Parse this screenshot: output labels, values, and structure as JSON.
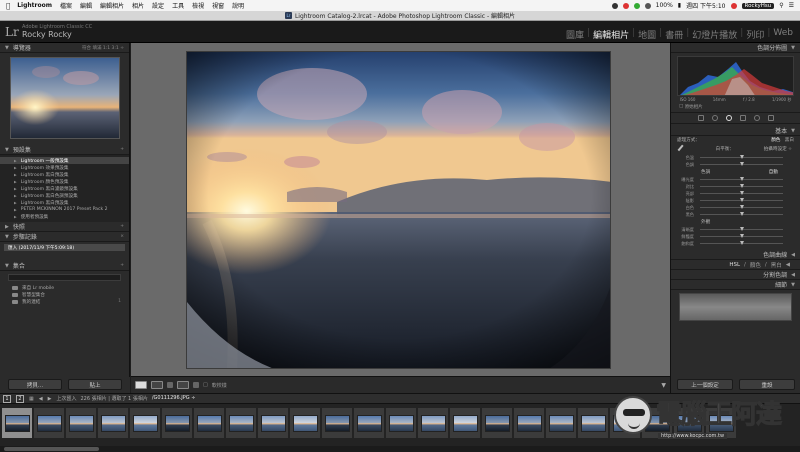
{
  "menubar": {
    "app": "Lightroom",
    "items": [
      "檔案",
      "編輯",
      "編輯相片",
      "相片",
      "設定",
      "工具",
      "檢視",
      "視窗",
      "說明"
    ],
    "battery": "100%",
    "clock": "週四 下午5:10",
    "user": "RockyHsu"
  },
  "window": {
    "title": "Lightroom Catalog-2.lrcat - Adobe Photoshop Lightroom Classic - 編輯相片"
  },
  "identity": {
    "logo": "Lr",
    "subtitle": "Adobe Lightroom Classic CC",
    "name": "Rocky Rocky"
  },
  "modules": {
    "items": [
      "圖庫",
      "編輯相片",
      "地圖",
      "書冊",
      "幻燈片播放",
      "列印",
      "Web"
    ],
    "active_index": 1
  },
  "left": {
    "navigator": {
      "title": "導覽器",
      "options": "符合  填滿  1:1  3:1 ÷"
    },
    "presets": {
      "title": "預設集",
      "items": [
        "Lightroom 一般預設集",
        "Lightroom 效果預設集",
        "Lightroom 黑白預設集",
        "Lightroom 顏色預設集",
        "Lightroom 黑白濾鏡預設集",
        "Lightroom 黑白色調預設集",
        "Lightroom 黑白預設集",
        "PETER MCKINNON 2017 Preset Pack 2",
        "使用者預設集"
      ],
      "selected_index": 0
    },
    "snapshots": {
      "title": "快照"
    },
    "history": {
      "title": "步驟記錄",
      "item": "匯入 (2017/11/9 下午5:09:18)"
    },
    "collections": {
      "title": "集合",
      "search_placeholder": "",
      "items": [
        {
          "name": "來自 Lr mobile",
          "count": ""
        },
        {
          "name": "智慧型集合",
          "count": ""
        },
        {
          "name": "我的連結",
          "count": "1"
        }
      ]
    },
    "buttons": {
      "copy": "拷貝...",
      "paste": "貼上"
    }
  },
  "right": {
    "histogram": {
      "title": "色調分佈圖",
      "info": [
        "ISO 160",
        "14mm",
        "f / 2.8",
        "1/1900 秒"
      ],
      "original": "原始相片"
    },
    "basic": {
      "title": "基本",
      "treatment_label": "處理方式：",
      "color": "顏色",
      "bw": "黑白",
      "wb_label": "白平衡：",
      "wb_value": "拍攝時設定 ÷",
      "sliders_wb": [
        {
          "label": "色溫",
          "pos": 0.5,
          "value": ""
        },
        {
          "label": "色調",
          "pos": 0.5,
          "value": ""
        }
      ],
      "tone_label": "色調",
      "tone_auto": "自動",
      "sliders_tone": [
        {
          "label": "曝光度",
          "pos": 0.5,
          "value": ""
        },
        {
          "label": "對比",
          "pos": 0.5,
          "value": ""
        },
        {
          "label": "亮部",
          "pos": 0.5,
          "value": ""
        },
        {
          "label": "陰影",
          "pos": 0.5,
          "value": ""
        },
        {
          "label": "白色",
          "pos": 0.5,
          "value": ""
        },
        {
          "label": "黑色",
          "pos": 0.5,
          "value": ""
        }
      ],
      "presence_label": "外觀",
      "sliders_presence": [
        {
          "label": "清晰度",
          "pos": 0.5,
          "value": ""
        },
        {
          "label": "鮮豔度",
          "pos": 0.5,
          "value": ""
        },
        {
          "label": "飽和度",
          "pos": 0.5,
          "value": ""
        }
      ]
    },
    "tone_curve": {
      "title": "色調曲線"
    },
    "hsl": {
      "tabs": [
        "HSL",
        "顏色",
        "黑白"
      ],
      "sep": "/"
    },
    "split_toning": {
      "title": "分割色調"
    },
    "calibration": {
      "title": "細節"
    },
    "buttons": {
      "previous": "上一個設定",
      "reset": "重設"
    }
  },
  "toolbar": {
    "label": "軟校樣"
  },
  "filmstrip": {
    "page1": "1",
    "page2": "2",
    "source": "上次匯入",
    "count": "226 張相片 | 選取了 1 張相片",
    "filename": "/G0111296.JPG ÷",
    "thumb_count": 23,
    "selected_index": 0
  },
  "watermark": {
    "text": "電腦王阿達",
    "sub": "http://www.kocpc.com.tw"
  }
}
